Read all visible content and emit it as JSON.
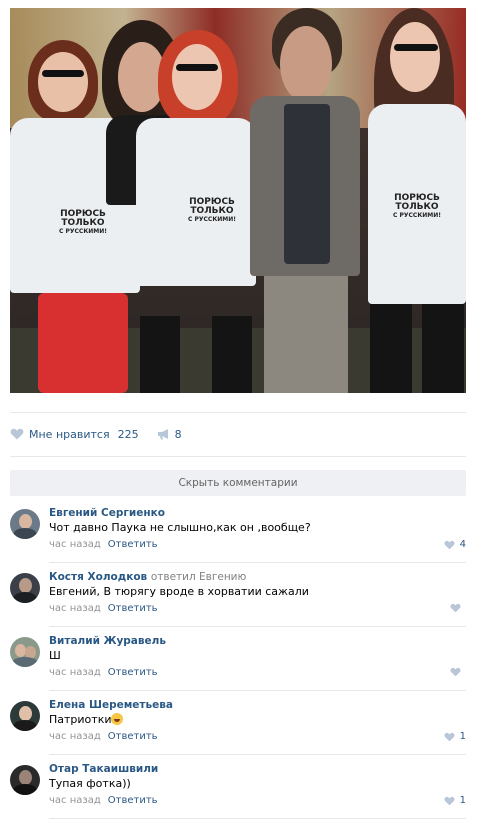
{
  "post": {
    "photo_alt": "",
    "shirt_text": [
      "ПОРЮСЬ",
      "ТОЛЬКО",
      "С РУССКИМИ!"
    ]
  },
  "actions": {
    "like_label": "Мне нравится",
    "like_count": "225",
    "share_count": "8"
  },
  "hide_comments_label": "Скрыть комментарии",
  "comments": [
    {
      "author": "Евгений Сергиенко",
      "replied_to": "",
      "text": "Чот давно Паука не слышно,как он ,вообще?",
      "time": "час назад",
      "reply_label": "Ответить",
      "likes": "4",
      "avatar_color": "#6a7a88"
    },
    {
      "author": "Костя Холодков",
      "replied_to": "ответил Евгению",
      "text": "Евгений, В тюрягу вроде в хорватии сажали",
      "time": "час назад",
      "reply_label": "Ответить",
      "likes": "",
      "avatar_color": "#3a3f48"
    },
    {
      "author": "Виталий Журавель",
      "replied_to": "",
      "text": "Ш",
      "time": "час назад",
      "reply_label": "Ответить",
      "likes": "",
      "avatar_color": "#8a9a8a"
    },
    {
      "author": "Елена Шереметьева",
      "replied_to": "",
      "text": "Патриотки",
      "time": "час назад",
      "reply_label": "Ответить",
      "likes": "1",
      "avatar_color": "#2c3a3a"
    },
    {
      "author": "Отар Такаишвили",
      "replied_to": "",
      "text": "Тупая фотка))",
      "time": "час назад",
      "reply_label": "Ответить",
      "likes": "1",
      "avatar_color": "#2a2a2a"
    }
  ],
  "colors": {
    "link": "#2a5885",
    "muted": "#939393",
    "divider": "#e7e8ec",
    "button_bg": "#eef0f3"
  }
}
